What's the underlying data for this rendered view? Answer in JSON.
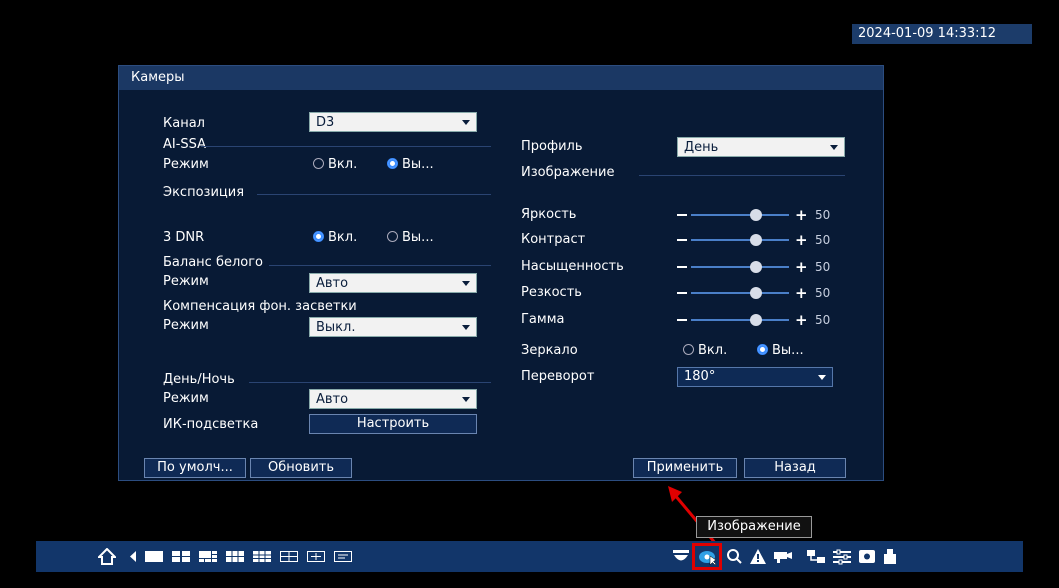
{
  "datetime": "2024-01-09 14:33:12",
  "window": {
    "title": "Камеры"
  },
  "left": {
    "channel": {
      "label": "Канал",
      "value": "D3"
    },
    "aissa": {
      "section": "AI-SSA",
      "mode_label": "Режим",
      "opt_on": "Вкл.",
      "opt_off": "Вы...",
      "selected": "off"
    },
    "exposure": {
      "section": "Экспозиция"
    },
    "dnr": {
      "label": "3 DNR",
      "opt_on": "Вкл.",
      "opt_off": "Вы...",
      "selected": "on"
    },
    "white_balance": {
      "section": "Баланс белого",
      "mode_label": "Режим",
      "value": "Авто"
    },
    "backlight": {
      "section": "Компенсация фон. засветки",
      "mode_label": "Режим",
      "value": "Выкл."
    },
    "daynight": {
      "section": "День/Ночь",
      "mode_label": "Режим",
      "value": "Авто"
    },
    "ir": {
      "label": "ИК-подсветка",
      "button": "Настроить"
    }
  },
  "right": {
    "profile": {
      "label": "Профиль",
      "value": "День"
    },
    "image_section": "Изображение",
    "sliders": [
      {
        "label": "Яркость",
        "value": 50
      },
      {
        "label": "Контраст",
        "value": 50
      },
      {
        "label": "Насыщенность",
        "value": 50
      },
      {
        "label": "Резкость",
        "value": 50
      },
      {
        "label": "Гамма",
        "value": 50
      }
    ],
    "mirror": {
      "label": "Зеркало",
      "opt_on": "Вкл.",
      "opt_off": "Вы...",
      "selected": "off"
    },
    "flip": {
      "label": "Переворот",
      "value": "180°"
    }
  },
  "buttons": {
    "default": "По умолч...",
    "refresh": "Обновить",
    "apply": "Применить",
    "back": "Назад"
  },
  "tooltip": "Изображение",
  "taskbar": {
    "icons": [
      "home-icon",
      "prev-arrow-icon",
      "view-1-icon",
      "view-4-icon",
      "view-6-icon",
      "view-8-icon",
      "view-9-icon",
      "view-16-icon",
      "view-25-icon",
      "sequence-icon",
      "ptz-icon",
      "image-settings-icon",
      "search-icon",
      "alarm-icon",
      "camera-icon",
      "network-icon",
      "settings-icon",
      "hdd-icon",
      "backup-icon"
    ]
  },
  "colors": {
    "accent": "#3a8cff",
    "panel": "#081a35",
    "highlight": "#e00000"
  }
}
